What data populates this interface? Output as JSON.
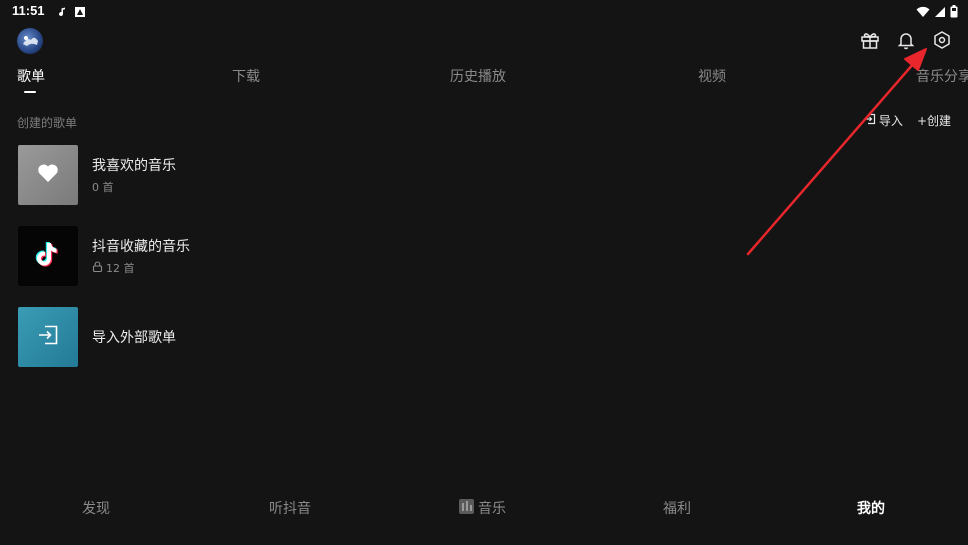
{
  "status_bar": {
    "time": "11:51"
  },
  "tabs": [
    {
      "label": "歌单",
      "active": true
    },
    {
      "label": "下载",
      "active": false
    },
    {
      "label": "历史播放",
      "active": false
    },
    {
      "label": "视频",
      "active": false
    },
    {
      "label": "音乐分享",
      "active": false
    }
  ],
  "section": {
    "title": "创建的歌单",
    "import_label": "导入",
    "create_label": "+创建"
  },
  "playlists": [
    {
      "title": "我喜欢的音乐",
      "subtitle": "0 首",
      "icon": "heart-icon",
      "locked": false
    },
    {
      "title": "抖音收藏的音乐",
      "subtitle": "12 首",
      "icon": "tiktok-logo",
      "locked": true
    },
    {
      "title": "导入外部歌单",
      "subtitle": "",
      "icon": "import-icon",
      "locked": false
    }
  ],
  "bottom_nav": [
    {
      "label": "发现",
      "active": false
    },
    {
      "label": "听抖音",
      "active": false
    },
    {
      "label": "音乐",
      "active": false
    },
    {
      "label": "福利",
      "active": false
    },
    {
      "label": "我的",
      "active": true
    }
  ],
  "colors": {
    "background": "#141414",
    "annotation_arrow": "#e8262b",
    "import_thumb": "#2a8aa6"
  }
}
